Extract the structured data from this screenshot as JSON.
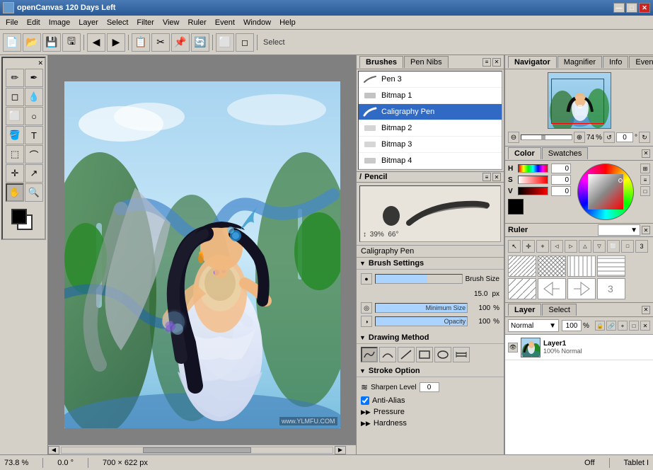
{
  "titleBar": {
    "title": "openCanvas 120 Days Left",
    "minBtn": "—",
    "maxBtn": "□",
    "closeBtn": "✕"
  },
  "menuBar": {
    "items": [
      "File",
      "Edit",
      "Image",
      "Layer",
      "Select",
      "Filter",
      "View",
      "Ruler",
      "Event",
      "Window",
      "Help"
    ]
  },
  "toolbar": {
    "buttons": [
      "📄",
      "📂",
      "💾",
      "🖫",
      "◀",
      "▶",
      "📋",
      "✂",
      "📌",
      "🔄",
      "⬜",
      "□",
      "◻"
    ]
  },
  "toolbox": {
    "tools": [
      "✏️",
      "🖊",
      "🪄",
      "💧",
      "⬜",
      "○",
      "🔺",
      "📝",
      "✂",
      "🪣",
      "🔍",
      "↔",
      "↕",
      "↗",
      "✋",
      "🔎"
    ]
  },
  "brushPanel": {
    "tabs": [
      "Brushes",
      "Pen Nibs"
    ],
    "activeTab": "Brushes",
    "items": [
      {
        "name": "Pen 3",
        "selected": false
      },
      {
        "name": "Bitmap 1",
        "selected": false
      },
      {
        "name": "Caligraphy Pen",
        "selected": true
      },
      {
        "name": "Bitmap 2",
        "selected": false
      },
      {
        "name": "Bitmap 3",
        "selected": false
      },
      {
        "name": "Bitmap 4",
        "selected": false
      }
    ]
  },
  "pencilPanel": {
    "title": "Pencil",
    "previewSize": "39%",
    "previewAngle": "66°",
    "brushName": "Caligraphy Pen",
    "brushSettings": {
      "title": "Brush Settings",
      "brushSize": {
        "label": "Brush Size",
        "value": "15.0",
        "unit": "px"
      },
      "minimumSize": {
        "label": "Minimum Size",
        "value": "100",
        "unit": "%"
      },
      "opacity": {
        "label": "Opacity",
        "value": "100",
        "unit": "%"
      }
    },
    "drawingMethod": {
      "title": "Drawing Method",
      "buttons": [
        "∞",
        "⌒",
        "⟨",
        "□",
        "○",
        "⌗"
      ]
    },
    "strokeOption": {
      "title": "Stroke Option",
      "sharpenLabel": "Sharpen Level",
      "sharpenValue": "0"
    },
    "antiAlias": "Anti-Alias",
    "pressure": "Pressure",
    "hardness": "Hardness"
  },
  "navigatorPanel": {
    "tabs": [
      "Navigator",
      "Magnifier",
      "Info",
      "Event"
    ],
    "activeTab": "Navigator",
    "zoom": "74",
    "zoomUnit": "%",
    "angle": "0",
    "angleUnit": "°"
  },
  "colorPanel": {
    "tabs": [
      "Color",
      "Swatches"
    ],
    "activeTab": "Color",
    "h": "0",
    "s": "0",
    "v": "0"
  },
  "rulerPanel": {
    "title": "Ruler",
    "dropdown": ""
  },
  "layerPanel": {
    "tabs": [
      "Layer",
      "Select"
    ],
    "activeTab": "Layer",
    "blendMode": "Normal",
    "opacity": "100",
    "opacityUnit": "%",
    "layers": [
      {
        "name": "Layer1",
        "desc": "100% Normal",
        "visible": true
      }
    ]
  },
  "statusBar": {
    "zoom": "73.8 %",
    "angle": "0.0 °",
    "size": "700 × 622 px",
    "tablet": "Off",
    "tabletLabel": "Tablet I"
  },
  "icons": {
    "pen": "✒",
    "bitmap": "🖼",
    "eye": "👁",
    "lock": "🔒",
    "link": "🔗",
    "magnify_plus": "⊕",
    "magnify_minus": "⊖",
    "rotate": "↺",
    "rotate_r": "↻",
    "flip_h": "↔",
    "arrow_chevron": "▼",
    "arrow_up": "▲",
    "close_x": "✕"
  }
}
